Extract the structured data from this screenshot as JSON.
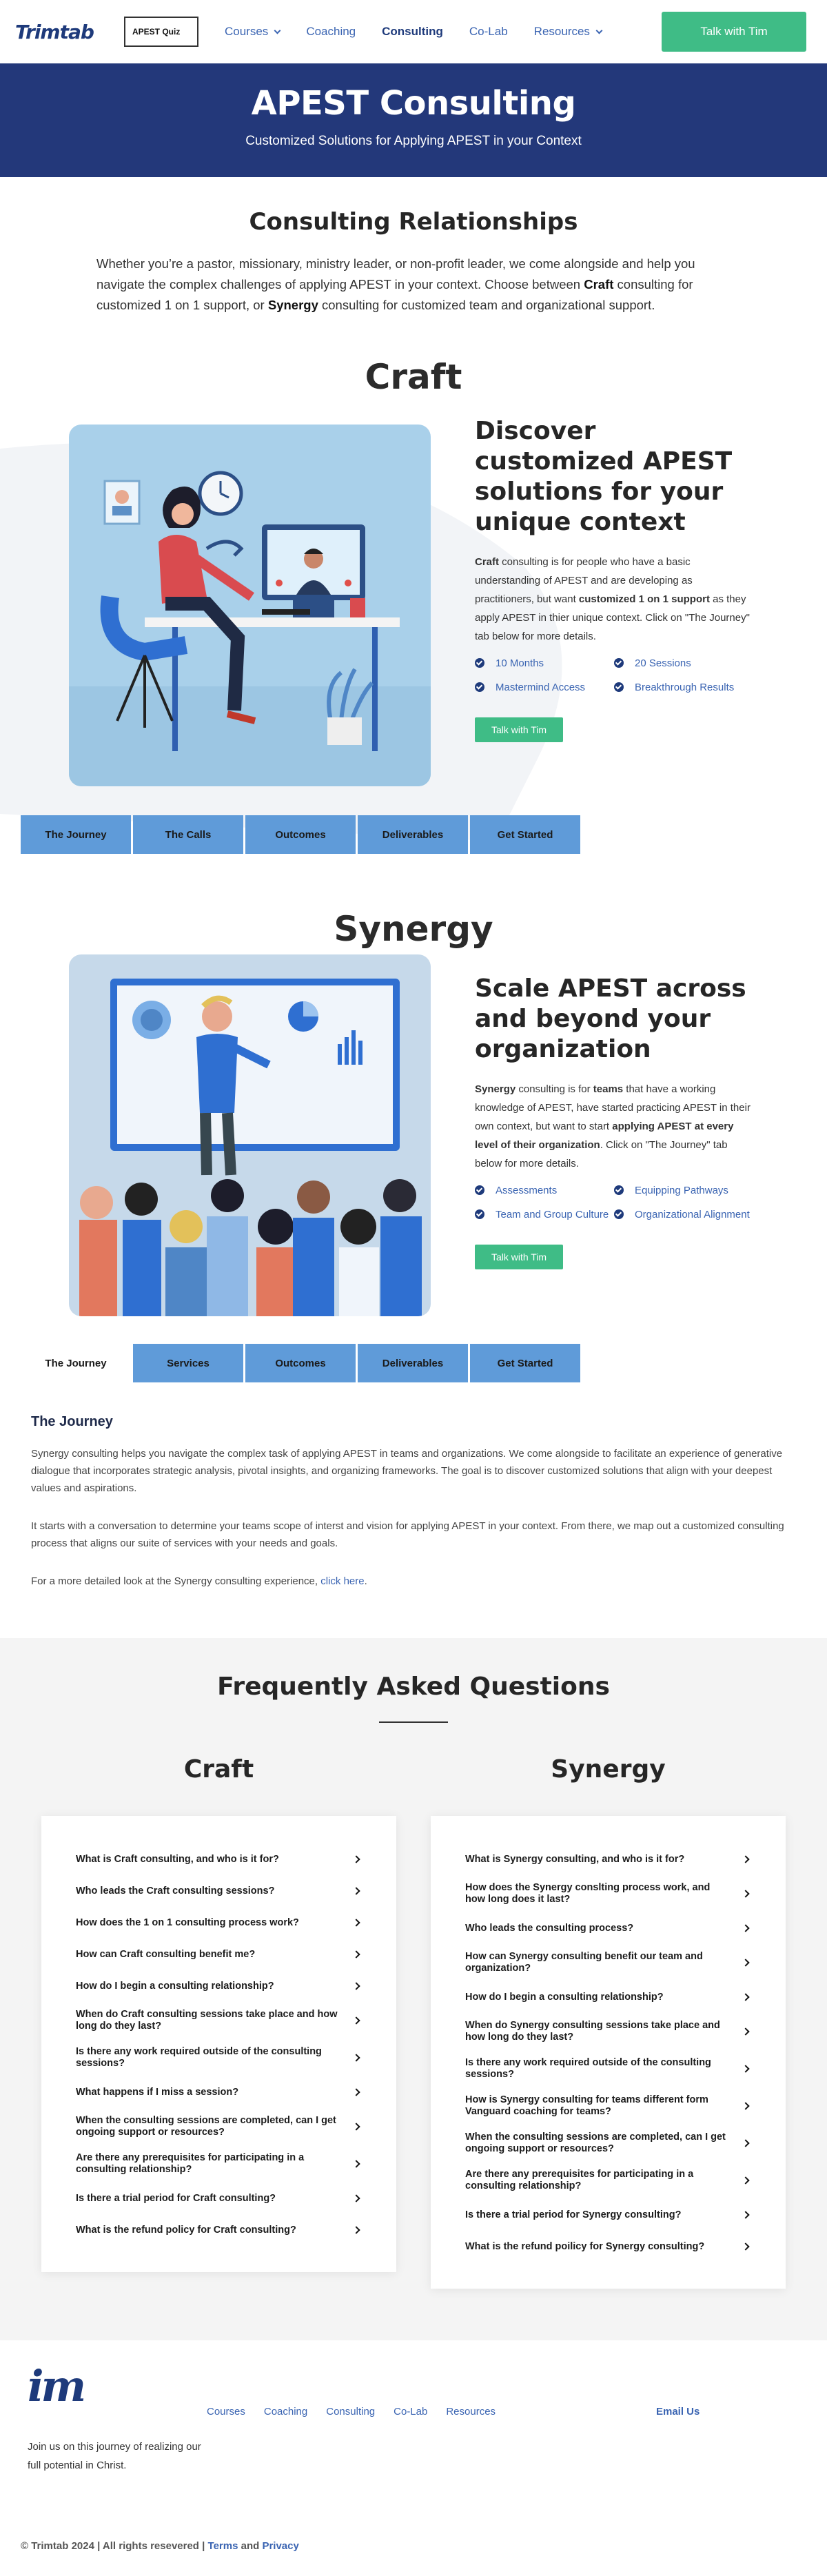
{
  "header": {
    "logo": "Trimtab",
    "quiz": "APEST Quiz",
    "nav": [
      {
        "label": "Courses",
        "dropdown": true,
        "active": false
      },
      {
        "label": "Coaching",
        "dropdown": false,
        "active": false
      },
      {
        "label": "Consulting",
        "dropdown": false,
        "active": true
      },
      {
        "label": "Co-Lab",
        "dropdown": false,
        "active": false
      },
      {
        "label": "Resources",
        "dropdown": true,
        "active": false
      }
    ],
    "cta": "Talk with Tim"
  },
  "hero": {
    "title": "APEST Consulting",
    "subtitle": "Customized Solutions for Applying APEST in your Context"
  },
  "intro": {
    "title": "Consulting Relationships",
    "text_before": "Whether you’re a pastor, missionary, ministry leader, or non-profit leader, we come alongside and help you navigate the complex challenges of applying APEST in your context. Choose between ",
    "bold1": "Craft",
    "text_mid": " consulting for customized 1 on 1 support, or ",
    "bold2": "Synergy",
    "text_after": " consulting for customized team and organizational support."
  },
  "craft": {
    "section_title": "Craft",
    "heading": "Discover customized APEST solutions for your unique context",
    "desc": {
      "b1": "Craft",
      "t1": " consulting is for people who have a basic understanding of APEST and are developing as practitioners, but want ",
      "b2": "customized 1 on 1 support",
      "t2": " as they apply APEST in thier unique context. Click on \"The Journey\" tab below for more details."
    },
    "bullets": [
      "10 Months",
      "20 Sessions",
      "Mastermind Access",
      "Breakthrough Results"
    ],
    "cta": "Talk with Tim",
    "tabs": [
      "The Journey",
      "The Calls",
      "Outcomes",
      "Deliverables",
      "Get Started"
    ]
  },
  "synergy": {
    "section_title": "Synergy",
    "heading": "Scale APEST across and beyond your organization",
    "desc": {
      "b1": "Synergy",
      "t1": " consulting is for ",
      "b2": "teams",
      "t2": " that have a working knowledge of APEST, have started practicing APEST in their own context, but want to start ",
      "b3": "applying APEST at every level of their organization",
      "t3": ". Click on \"The Journey\" tab below for more details."
    },
    "bullets": [
      "Assessments",
      "Equipping Pathways",
      "Team and Group Culture",
      "Organizational Alignment"
    ],
    "cta": "Talk with Tim",
    "tabs": [
      "The Journey",
      "Services",
      "Outcomes",
      "Deliverables",
      "Get Started"
    ],
    "active_tab": {
      "title": "The Journey",
      "p1": "Synergy consulting helps you navigate the complex task of applying APEST in teams and organizations. We come alongside to facilitate an experience of generative dialogue that incorporates strategic analysis, pivotal insights, and organizing frameworks. The goal is to discover customized solutions that align with your deepest values and aspirations.",
      "p2": "It starts with a conversation to determine your teams scope of interst and vision for applying APEST in your context. From there, we map out a customized consulting process that aligns our suite of services with your needs and goals.",
      "p3_before": "For a more detailed look at the Synergy consulting experience, ",
      "p3_link": "click here",
      "p3_after": "."
    }
  },
  "faq": {
    "title": "Frequently Asked Questions",
    "craft_title": "Craft",
    "synergy_title": "Synergy",
    "craft_questions": [
      "What is Craft consulting, and who is it for?",
      "Who leads the Craft consulting sessions?",
      "How does the 1 on 1 consulting process work?",
      "How can Craft consulting benefit me?",
      "How do I begin a consulting relationship?",
      "When do Craft consulting sessions take place and how long do they last?",
      "Is there any work required outside of the consulting sessions?",
      "What happens if I miss a session?",
      "When the consulting sessions are completed, can I get ongoing support or resources?",
      "Are there any prerequisites for participating in a consulting relationship?",
      "Is there a trial period for Craft consulting?",
      "What is the refund policy for Craft consulting?"
    ],
    "synergy_questions": [
      "What is Synergy consulting, and who is it for?",
      "How does the Synergy conslting process work, and how long does it last?",
      "Who leads the consulting process?",
      "How can Synergy consulting benefit our team and organization?",
      "How do I begin a consulting relationship?",
      "When do Synergy consulting sessions take place and how long do they last?",
      "Is there any work required outside of the consulting sessions?",
      "How is Synergy consulting for teams different form Vanguard coaching for teams?",
      "When the consulting sessions are completed, can I get ongoing support or resources?",
      "Are there any prerequisites for participating in a consulting relationship?",
      "Is there a trial period for Synergy consulting?",
      "What is the refund poilicy for Synergy consulting?"
    ]
  },
  "footer": {
    "logo": "im",
    "nav": [
      "Courses",
      "Coaching",
      "Consulting",
      "Co-Lab",
      "Resources"
    ],
    "email": "Email Us",
    "tagline": "Join us on this journey of realizing our full potential in Christ.",
    "copyright": "© Trimtab 2024 | All rights resevered | ",
    "terms": "Terms",
    "and": " and ",
    "privacy": "Privacy"
  },
  "colors": {
    "brand_navy": "#23387a",
    "link_blue": "#3a64b2",
    "cta_green": "#3fbc86",
    "tab_blue": "#5f9bd9"
  }
}
